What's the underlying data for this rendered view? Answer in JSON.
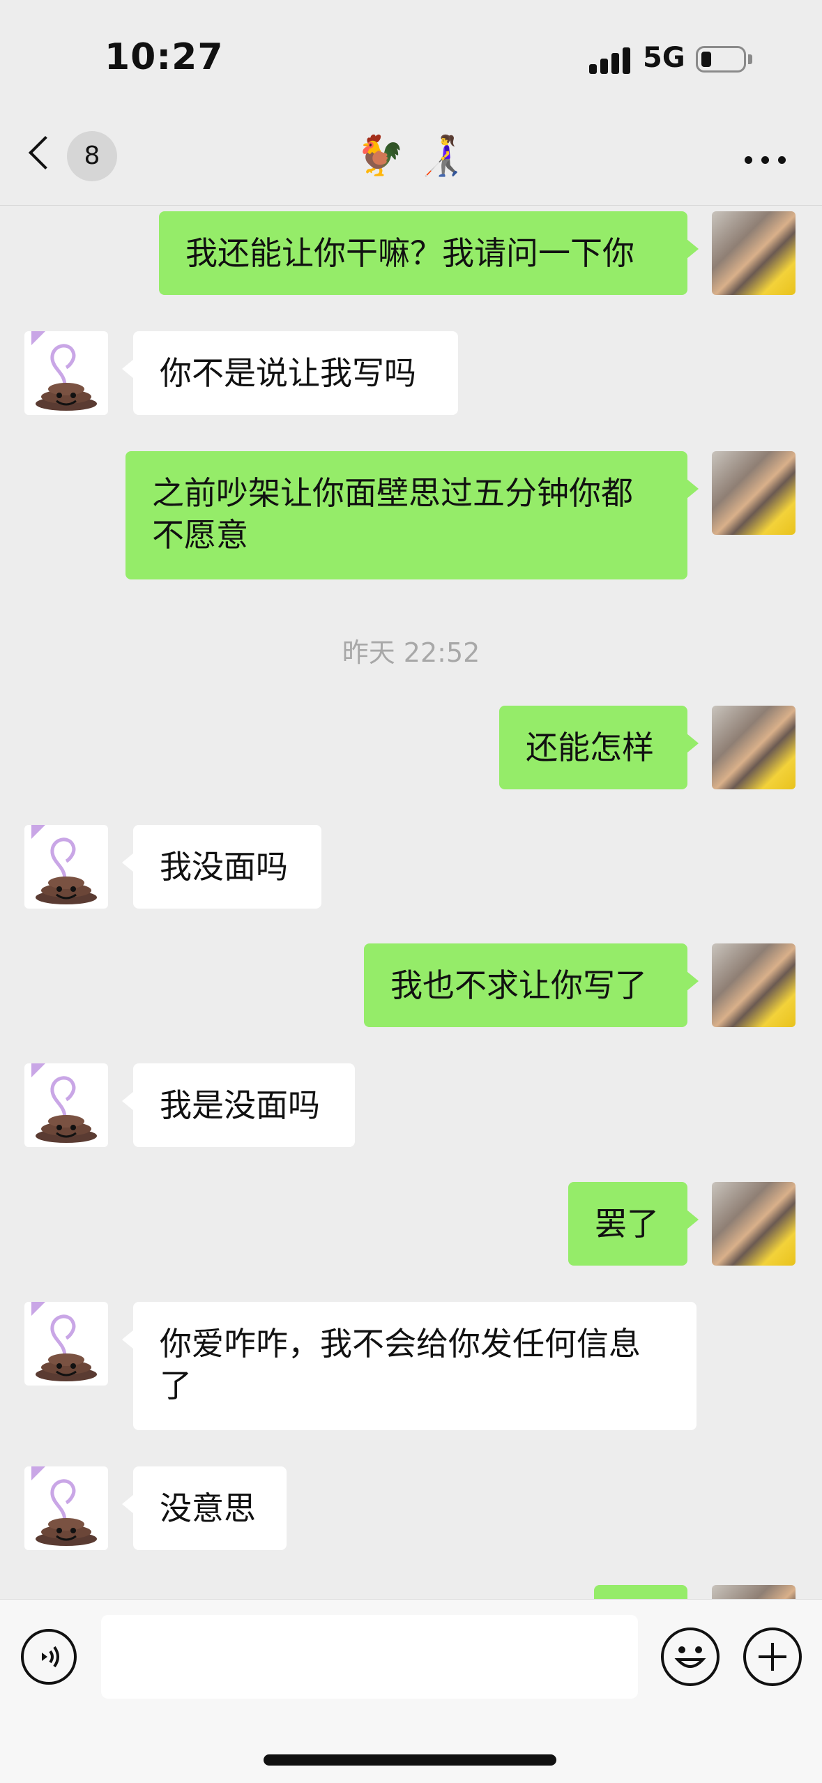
{
  "status_bar": {
    "time": "10:27",
    "network": "5G",
    "battery_level": 0.2
  },
  "nav": {
    "back_icon": "chevron-left-icon",
    "unread_count": "8",
    "title": "🐓 👩‍🦯",
    "more_icon": "more-dots-icon"
  },
  "messages": [
    {
      "sender": "me",
      "text": "我还能让你干嘛？我请问一下你"
    },
    {
      "sender": "other",
      "text": "你不是说让我写吗"
    },
    {
      "sender": "me",
      "text": "之前吵架让你面壁思过五分钟你都不愿意"
    },
    {
      "sender": "me",
      "text": "还能怎样"
    },
    {
      "sender": "other",
      "text": "我没面吗"
    },
    {
      "sender": "me",
      "text": "我也不求让你写了"
    },
    {
      "sender": "other",
      "text": "我是没面吗"
    },
    {
      "sender": "me",
      "text": "罢了"
    },
    {
      "sender": "other",
      "text": "你爱咋咋，我不会给你发任何信息了"
    },
    {
      "sender": "other",
      "text": "没意思"
    }
  ],
  "timestamp": "昨天 22:52",
  "input_bar": {
    "voice_icon": "voice-icon",
    "emoji_icon": "emoji-icon",
    "plus_icon": "plus-icon",
    "input_value": ""
  },
  "colors": {
    "background": "#ededed",
    "my_bubble": "#95ec69",
    "other_bubble": "#ffffff"
  }
}
